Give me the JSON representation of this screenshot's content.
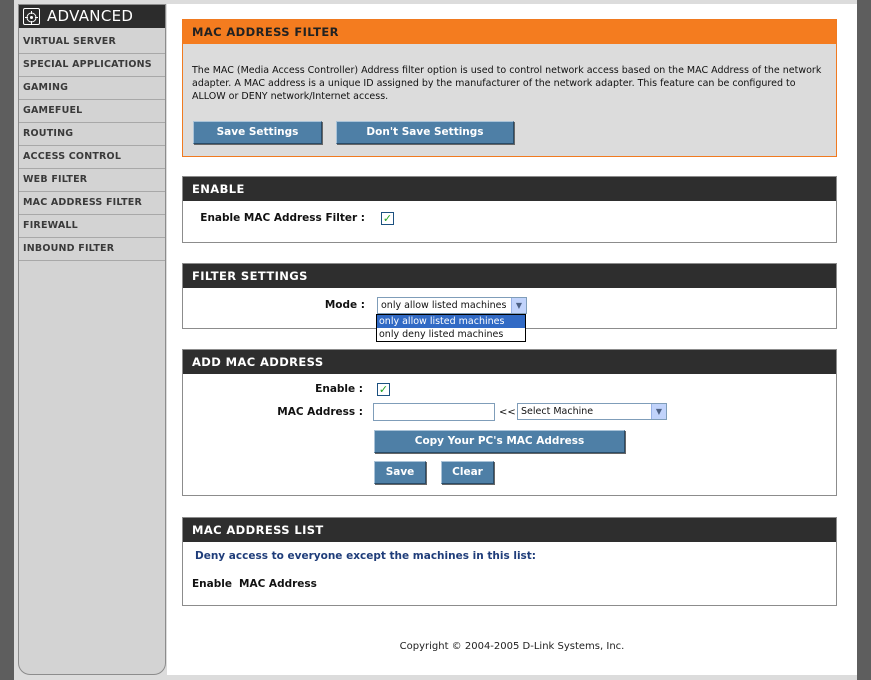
{
  "sidebar": {
    "title": "ADVANCED",
    "items": [
      {
        "label": "VIRTUAL SERVER"
      },
      {
        "label": "SPECIAL APPLICATIONS"
      },
      {
        "label": "GAMING"
      },
      {
        "label": "GAMEFUEL"
      },
      {
        "label": "ROUTING"
      },
      {
        "label": "ACCESS CONTROL"
      },
      {
        "label": "WEB FILTER"
      },
      {
        "label": "MAC ADDRESS FILTER"
      },
      {
        "label": "FIREWALL"
      },
      {
        "label": "INBOUND FILTER"
      }
    ]
  },
  "intro": {
    "title": "MAC ADDRESS FILTER",
    "description": "The MAC (Media Access Controller) Address filter option is used to control network access based on the MAC Address of the network adapter. A MAC address is a unique ID assigned by the manufacturer of the network adapter. This feature can be configured to ALLOW or DENY network/Internet access.",
    "save_label": "Save Settings",
    "dont_save_label": "Don't Save Settings"
  },
  "enable_section": {
    "title": "ENABLE",
    "label": "Enable MAC Address Filter :",
    "checked": "✓"
  },
  "filter_settings": {
    "title": "FILTER SETTINGS",
    "mode_label": "Mode :",
    "mode_value": "only allow listed machines",
    "options": [
      "only allow listed machines",
      "only deny listed machines"
    ]
  },
  "add_mac": {
    "title": "ADD MAC ADDRESS",
    "enable_label": "Enable :",
    "enable_checked": "✓",
    "mac_label": "MAC Address :",
    "mac_value": "",
    "arrow_text": "<<",
    "machine_select": "Select Machine",
    "copy_label": "Copy Your PC's MAC Address",
    "save_label": "Save",
    "clear_label": "Clear"
  },
  "mac_list": {
    "title": "MAC ADDRESS LIST",
    "note": "Deny access to everyone except the machines in this list:",
    "col_enable": "Enable",
    "col_mac": "MAC Address"
  },
  "footer": {
    "copyright": "Copyright © 2004-2005 D-Link Systems, Inc."
  },
  "colors": {
    "accent_orange": "#f47c1f",
    "header_dark": "#2e2e2e",
    "button_blue": "#4e7fa6"
  }
}
